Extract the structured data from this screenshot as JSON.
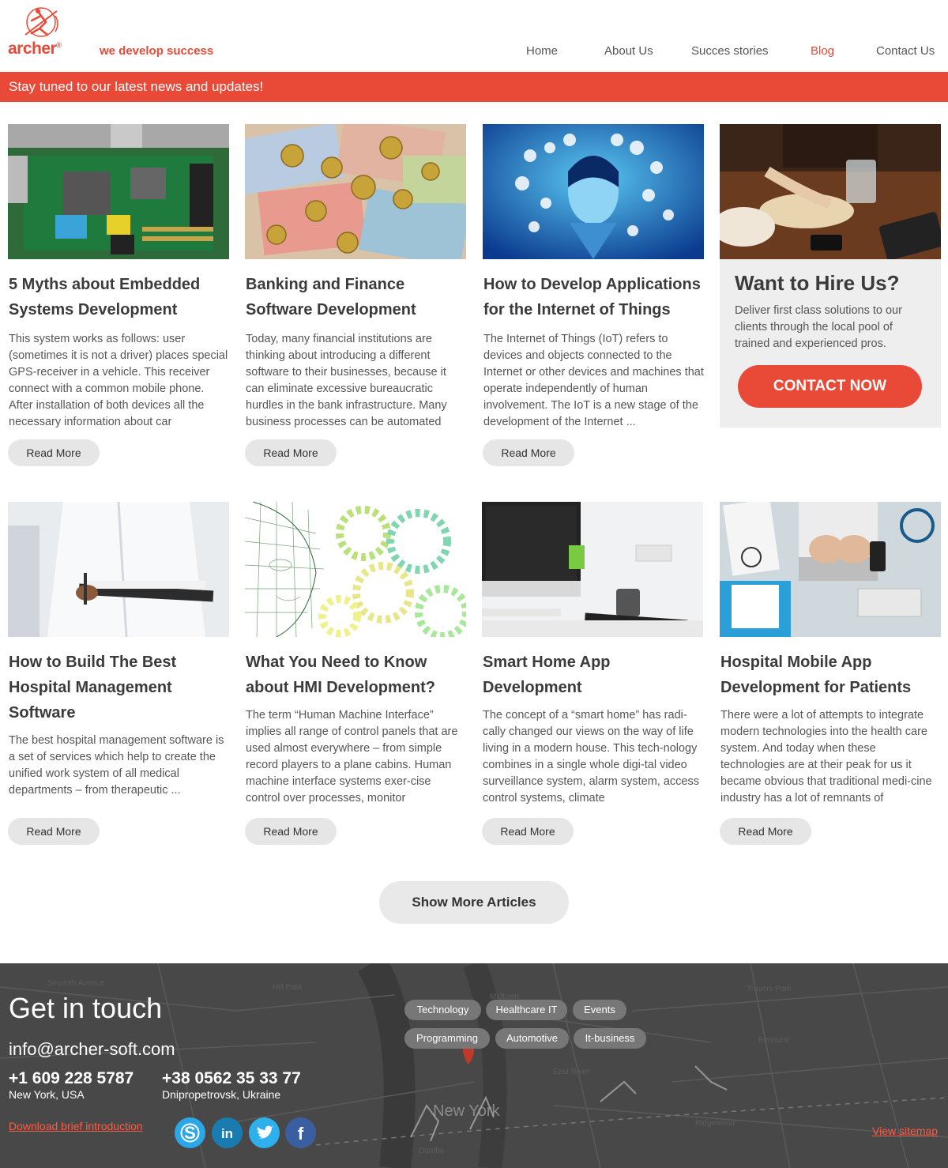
{
  "header": {
    "logo_text": "archer",
    "logo_mark": "®",
    "tagline": "we develop success",
    "nav": [
      "Home",
      "About Us",
      "Succes stories",
      "Blog",
      "Contact Us"
    ],
    "active_nav": "Blog",
    "accent_color": "#e84a37"
  },
  "banner": {
    "text": "Stay tuned to our latest news and updates!"
  },
  "articles": [
    {
      "title": "5 Myths about Embedded Systems Development",
      "excerpt": "This system works as follows: user (sometimes it is not a driver) places special GPS-receiver in a vehicle. This receiver connect with a common mobile phone. After installation of both devices all the necessary information about car",
      "button": "Read More"
    },
    {
      "title": "Banking and Finance Software Development",
      "excerpt": "Today, many financial institutions are thinking about introducing a different software to their businesses, because it can eliminate excessive bureaucratic hurdles in the bank infrastructure. Many business processes can be automated",
      "button": "Read More"
    },
    {
      "title": "How to Develop Applications for the Internet of Things",
      "excerpt": "The Internet of Things (IoT) refers to devices and objects connected to the Internet or other devices and machines that operate independently of human involvement. The IoT is a new stage of the development of the Internet ...",
      "button": "Read More"
    },
    {
      "title": "How to Build The Best Hospital Management Software",
      "excerpt": "The best hospital management software is a set of services which help to create the unified work system of all medical departments – from therapeutic ...",
      "button": "Read More"
    },
    {
      "title": "What You Need to Know about HMI Development?",
      "excerpt": "The term “Human Machine Interface” implies all range of control panels that are used almost everywhere – from simple record players to a plane cabins. Human machine interface systems exer-cise control over processes, monitor",
      "button": "Read More"
    },
    {
      "title": "Smart Home App Development",
      "excerpt": "The concept of a “smart home” has radi-cally changed our views on the way of life living in a modern house. This tech-nology combines in a single whole digi-tal video surveillance system, alarm system, access control systems, climate",
      "button": "Read More"
    },
    {
      "title": "Hospital Mobile App Development for Patients",
      "excerpt": "There were a lot of attempts to integrate modern technologies into the health care system. And today when these technologies are at their peak for us it became obvious that traditional medi-cine industry has a lot of remnants of",
      "button": "Read More"
    }
  ],
  "hire": {
    "title": "Want to Hire Us?",
    "text": "Deliver first class solutions to our clients through the local pool of trained and experienced pros.",
    "button": "CONTACT NOW"
  },
  "show_more": "Show More Articles",
  "footer": {
    "heading": "Get in touch",
    "email": "info@archer-soft.com",
    "phones": [
      {
        "number": "+1 609 228 5787",
        "city": "New York, USA"
      },
      {
        "number": "+38 0562 35 33 77",
        "city": "Dnipropetrovsk, Ukraine"
      }
    ],
    "download": "Download brief introduction",
    "tags": [
      "Technology",
      "Healthcare IT",
      "Events",
      "Programming",
      "Automotive",
      "It-business"
    ],
    "social": [
      "skype-icon",
      "linkedin-icon",
      "twitter-icon",
      "facebook-icon"
    ],
    "sitemap": "View sitemap",
    "map_label": "New York"
  }
}
